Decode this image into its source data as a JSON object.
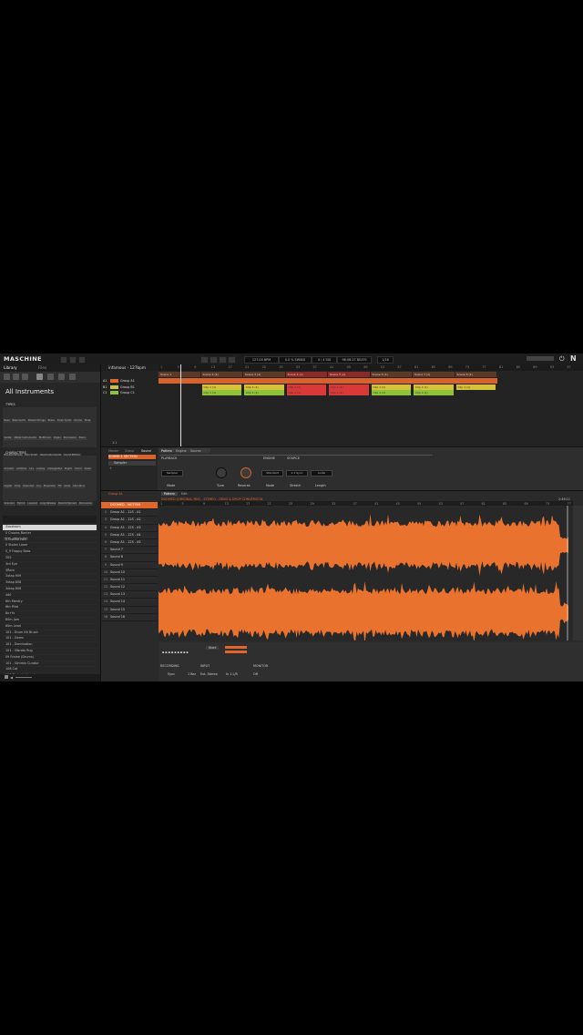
{
  "app": {
    "title": "MASCHINE",
    "project": "infamous - 127bpm"
  },
  "transport": {
    "tempo": "127.00",
    "tempo_unit": "BPM",
    "swing": "0.0 %",
    "swing_label": "SWING",
    "signature": "4 / 4",
    "signature_label": "SIG",
    "position": "96:08:27",
    "position_label": "BEATS",
    "grid": "1/16"
  },
  "browser": {
    "tabs": [
      "Library",
      "Files"
    ],
    "heading": "All Instruments",
    "types_title": "TYPES",
    "types": [
      "Bass",
      "Bass Synth",
      "Bowed Strings",
      "Brass",
      "Drum Synth",
      "Drums",
      "Flute",
      "Guitar",
      "Mallet Instruments",
      "Multitrack",
      "Organ",
      "Percussion",
      "Piano",
      "Plucked Strings",
      "Poly Synth",
      "Reed Instruments",
      "Sound Effects",
      "Soundscapes",
      "Synth Lead",
      "Synth Misc",
      "Synth Pad",
      "Voice"
    ],
    "characters_title": "CHARACTERS",
    "characters": [
      "Acoustic",
      "Additive",
      "Airy",
      "Analog",
      "Arpeggiated",
      "Bright",
      "Chord",
      "Clean",
      "Digital",
      "Dirty",
      "Distorted",
      "Dry",
      "Ensemble",
      "FM",
      "Glide",
      "Intro-Mod",
      "Granular",
      "Hybrid",
      "Layered",
      "Long Release",
      "Melodic/Spread",
      "Percussive",
      "Physical Model",
      "Processed",
      "Sample-based",
      "Short Release",
      "Synthetic",
      "Tonal",
      "Warm",
      "Wet"
    ],
    "files": [
      "Zoozloom",
      "0 Crowns Banter",
      "0 Dunkie Rod",
      "0 Stolen Loom",
      "0_9 Floppy Bass",
      "202",
      "3rd Eye",
      "3Rem",
      "3xtap 909",
      "3xtap 808",
      "3xtap 606",
      "4d0",
      "6th Mentry",
      "6th Pilot",
      "8v+fx",
      "8Sm Jam",
      "8Sm Lead",
      "101 - Drum Kit Brush",
      "101 - Gears",
      "101 - Domination",
      "101 - Vibrato Rug",
      "09 Frame (Drums)",
      "101 - Gimmix Curator",
      "108 Cat",
      "100 Distorted Lead",
      "100 Vibe Lead",
      "100 Mood Choir",
      "100 Phasis Lead"
    ],
    "selected_file_index": 0
  },
  "arranger": {
    "groups": [
      {
        "slot": "A1",
        "name": "Group A1",
        "color": "#e0662c"
      },
      {
        "slot": "B1",
        "name": "Group B1",
        "color": "#c9c24a"
      },
      {
        "slot": "C1",
        "name": "Group C1",
        "color": "#8fc43a"
      }
    ],
    "scenes": [
      "Scene 1",
      "Scene 2 (1)",
      "Scene 3 (1)",
      "Scene 4 (1)",
      "Scene 5 (1)",
      "Scene 6 (1)",
      "Scene 7 (1)",
      "Scene 8 (1)"
    ],
    "bar_numbers": [
      "1",
      "5",
      "9",
      "13",
      "17",
      "21",
      "25",
      "29",
      "33",
      "37",
      "41",
      "45",
      "49",
      "53",
      "57",
      "61",
      "65",
      "69",
      "73",
      "77",
      "81",
      "85",
      "89",
      "93",
      "97"
    ],
    "clip_label": "Clip 1 (1)",
    "bottom_left": "1:1"
  },
  "control": {
    "tabs": [
      "Master",
      "Group",
      "Sound"
    ],
    "section_tabs": [
      "Pattern",
      "Engine",
      "Source"
    ],
    "plugin_name": "Sampler",
    "slot": "SOUND 1 SECTION",
    "playback_title": "PLAYBACK",
    "engine_title": "ENGINE",
    "source_title": "SOURCE",
    "knobs": [
      "Mode",
      "Tune",
      "Reverse",
      "Mode",
      "Stretch",
      "Length"
    ],
    "values": [
      "Sampler",
      "0.00",
      "Off",
      "Standard",
      "1:1 Sync",
      "Audio"
    ]
  },
  "editor": {
    "tabs": [
      "Pattern",
      "Edit"
    ],
    "group_label": "Group A1",
    "sounds": [
      "DOOMED - MOTION",
      "Group A1 - 12S - A1",
      "Group A1 - 12S - A2",
      "Group A1 - 12S - A3",
      "Group A1 - 12S - A4",
      "Group A1 - 12S - A5",
      "Sound 7",
      "Sound 8",
      "Sound 9",
      "Sound 10",
      "Sound 11",
      "Sound 12",
      "Sound 13",
      "Sound 14",
      "Sound 15",
      "Sound 16"
    ],
    "waveform_title": "DOOMED (ORIGINAL MIX) - STEREO - DRAG & DROP CONVERSION",
    "length_readout": "2:46:11",
    "bar_numbers": [
      "1",
      "5",
      "9",
      "13",
      "17",
      "21",
      "25",
      "29",
      "33",
      "37",
      "41",
      "45",
      "49",
      "53",
      "57",
      "61",
      "65",
      "69",
      "73",
      "77"
    ],
    "recording_title": "RECORDING",
    "input_title": "INPUT",
    "monitor_title": "MONITOR",
    "rec_values": [
      "Sync",
      "1 Bar",
      "Ext. Stereo",
      "In 1 L/R",
      "Off"
    ],
    "start_label": "Start",
    "wave_color": "#e8722e"
  }
}
